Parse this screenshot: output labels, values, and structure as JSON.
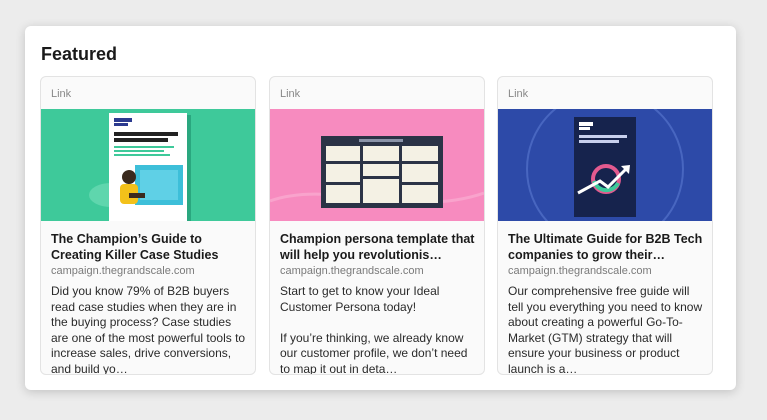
{
  "section": {
    "title": "Featured"
  },
  "cards": [
    {
      "tag": "Link",
      "title": "The Champion’s Guide to Creating Killer Case Studies",
      "domain": "campaign.thegrandscale.com",
      "description": "Did you know 79% of B2B buyers read case studies when they are in the buying process? Case studies are one of the most powerful tools to increase sales, drive conversions, and build yo…",
      "thumb": {
        "brand": "GRAND SCALE",
        "heading": "The champion’s guide to creating killer case studies",
        "bg": "#3ec99a",
        "icon": "case-study-guide-thumbnail"
      }
    },
    {
      "tag": "Link",
      "title": "Champion persona template that will help you revolutionis…",
      "domain": "campaign.thegrandscale.com",
      "description": "Start to get to know your Ideal Customer Persona today!\n\nIf you’re thinking, we already know our customer profile, we don’t need to map it out in deta…",
      "thumb": {
        "bg": "#f78bbf",
        "icon": "persona-template-thumbnail"
      }
    },
    {
      "tag": "Link",
      "title": "The Ultimate Guide for B2B Tech companies to grow their…",
      "domain": "campaign.thegrandscale.com",
      "description": "Our comprehensive free guide will tell you everything you need to know about creating a powerful Go-To-Market (GTM) strategy that will ensure your business or product launch is a…",
      "thumb": {
        "brand": "GRAND SCALE",
        "bg": "#2d4aa8",
        "icon": "gtm-guide-thumbnail"
      }
    }
  ]
}
